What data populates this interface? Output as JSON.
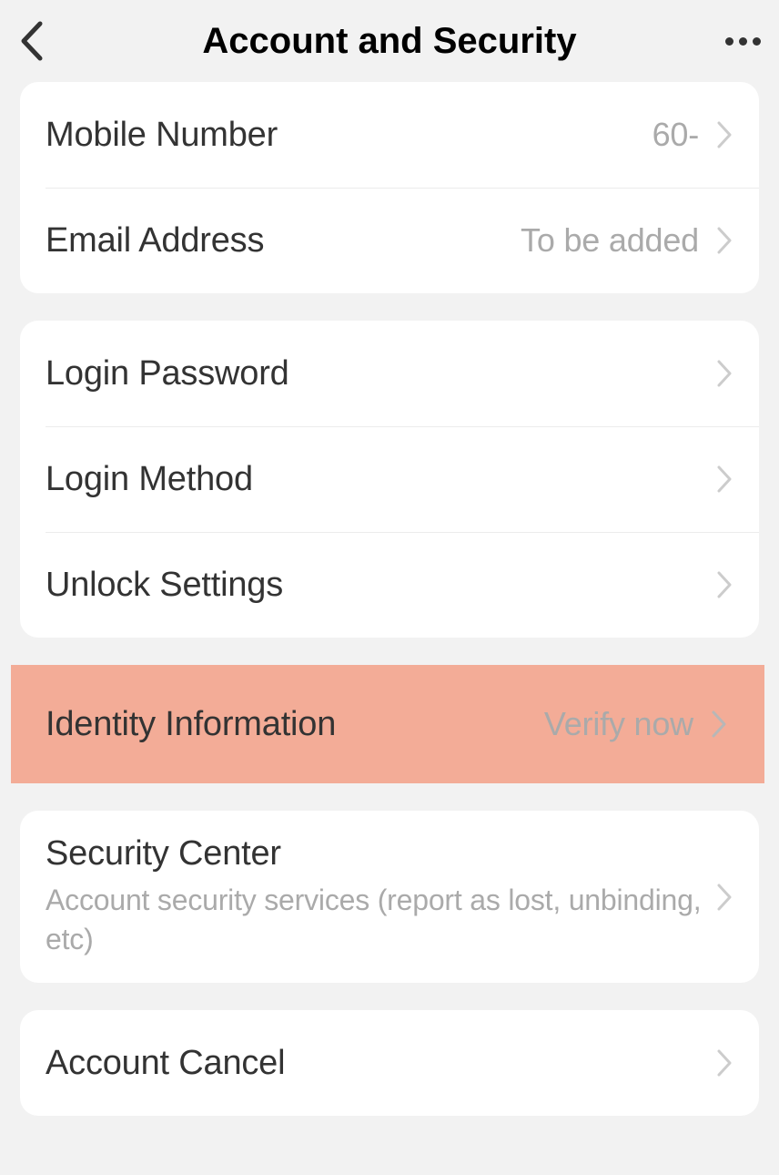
{
  "header": {
    "title": "Account and Security"
  },
  "groups": {
    "g1": {
      "mobile_number_label": "Mobile Number",
      "mobile_number_value": "60-",
      "email_label": "Email Address",
      "email_value": "To be added"
    },
    "g2": {
      "login_password_label": "Login Password",
      "login_method_label": "Login Method",
      "unlock_settings_label": "Unlock Settings"
    },
    "g3": {
      "identity_label": "Identity Information",
      "identity_value": "Verify now"
    },
    "g4": {
      "security_center_label": "Security Center",
      "security_center_sublabel": "Account security services (report as lost, unbinding, etc)"
    },
    "g5": {
      "account_cancel_label": "Account Cancel"
    }
  }
}
